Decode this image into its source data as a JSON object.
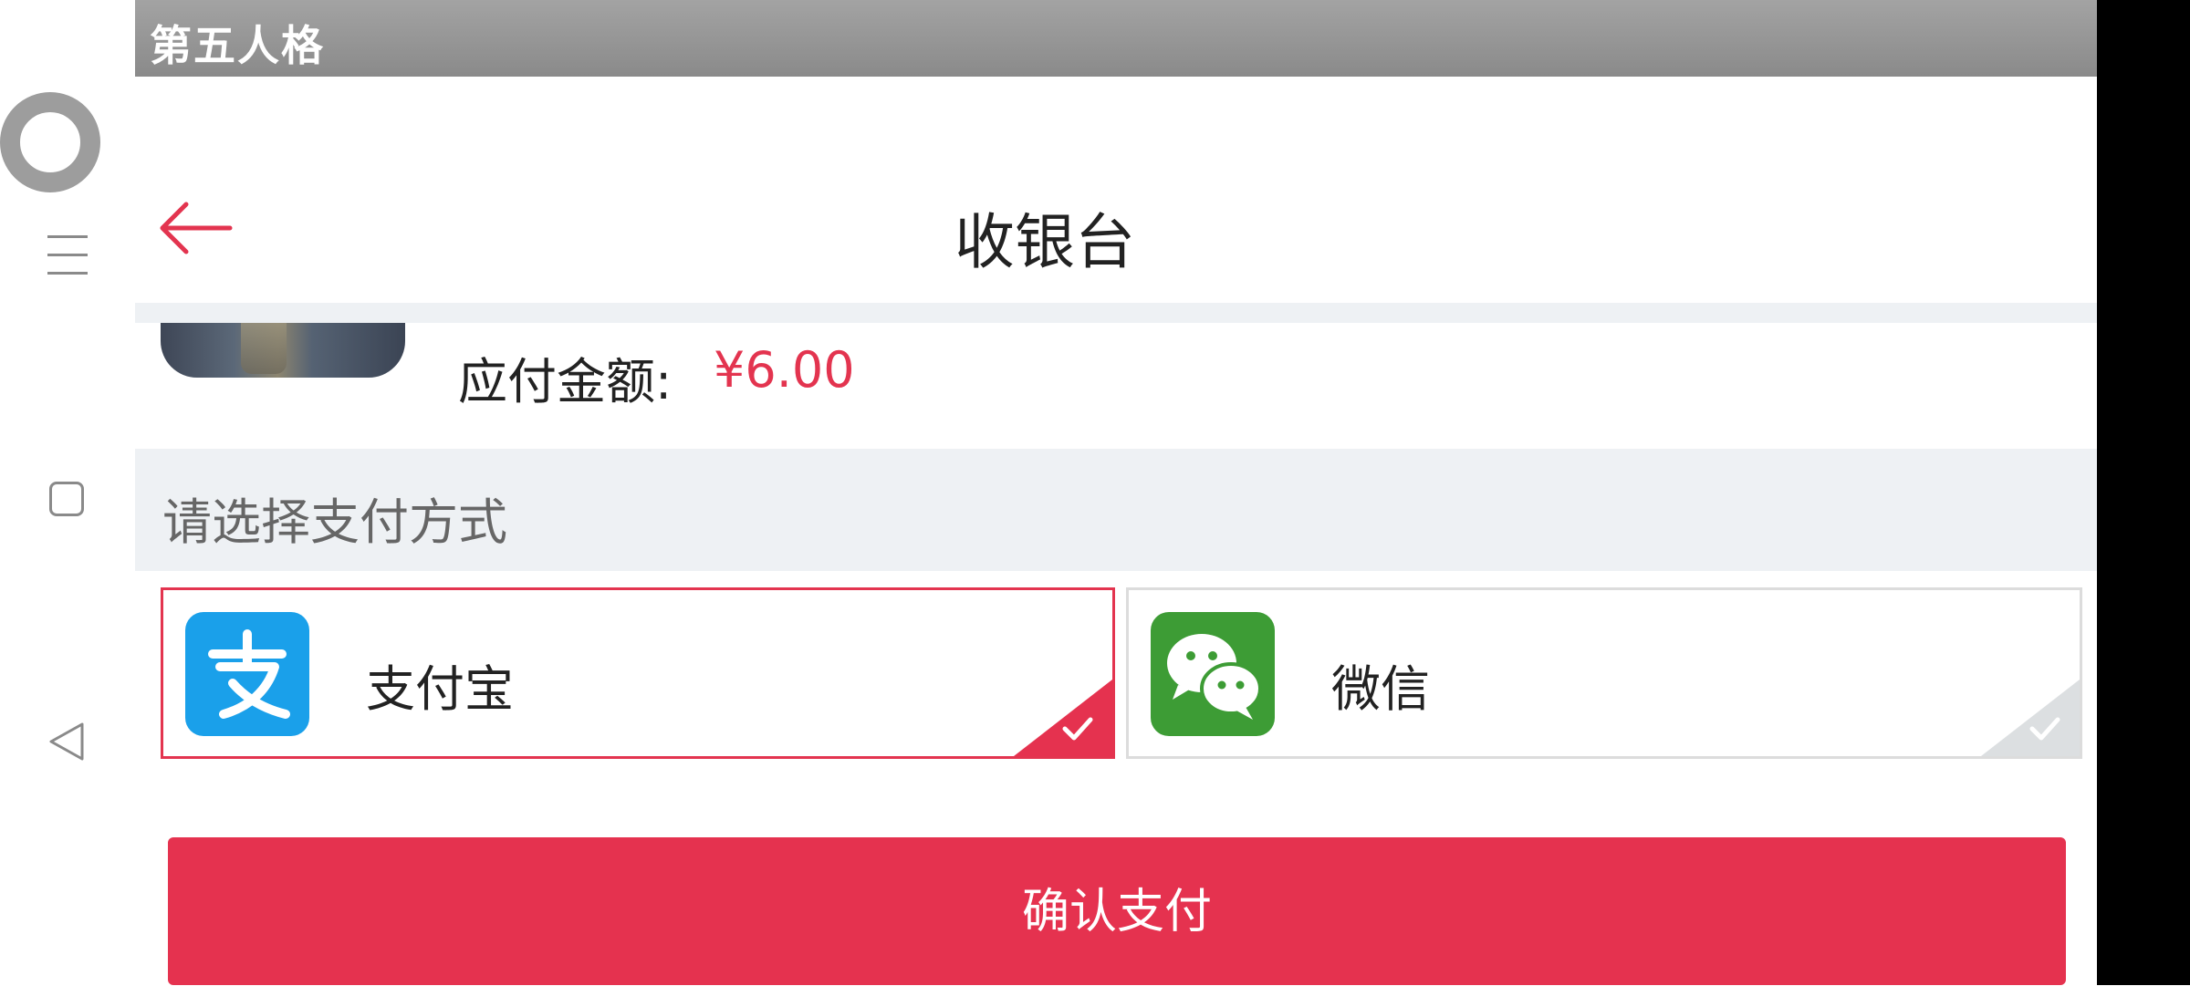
{
  "window": {
    "title": "第五人格"
  },
  "header": {
    "title": "收银台",
    "back_icon": "arrow-left-icon"
  },
  "order": {
    "amount_label": "应付金额:",
    "amount_value": "¥6.00"
  },
  "payment": {
    "section_label": "请选择支付方式",
    "selected": "alipay",
    "options": [
      {
        "id": "alipay",
        "label": "支付宝",
        "icon": "alipay-icon",
        "selected": true
      },
      {
        "id": "wechat",
        "label": "微信",
        "icon": "wechat-icon",
        "selected": false
      }
    ]
  },
  "confirm": {
    "label": "确认支付"
  },
  "colors": {
    "accent": "#e5324f",
    "alipay_blue": "#1aa0ea",
    "wechat_green": "#3d9c35",
    "section_bg": "#eef1f4"
  },
  "system_nav": {
    "icons": [
      "screen-record-icon",
      "menu-icon",
      "recent-apps-icon",
      "back-triangle-icon"
    ]
  }
}
